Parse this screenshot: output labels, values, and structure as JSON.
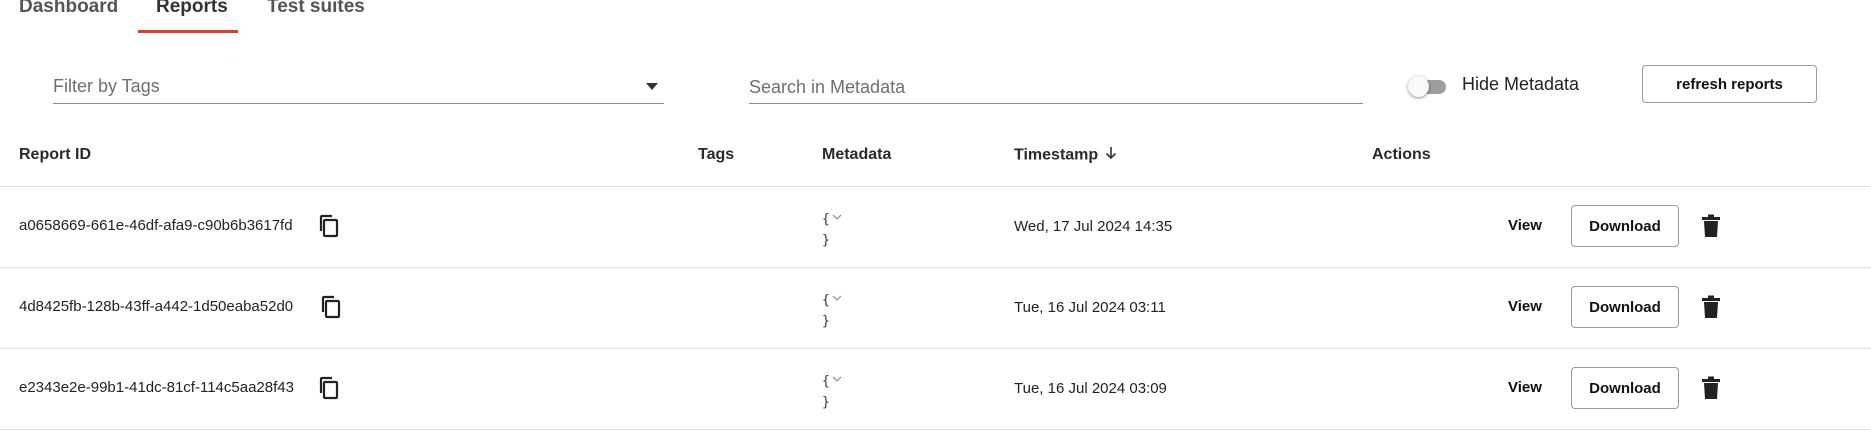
{
  "tabs": [
    {
      "label": "Dashboard",
      "active": false
    },
    {
      "label": "Reports",
      "active": true
    },
    {
      "label": "Test suites",
      "active": false
    }
  ],
  "filters": {
    "tags_placeholder": "Filter by Tags",
    "search_placeholder": "Search in Metadata",
    "hide_metadata_label": "Hide Metadata",
    "hide_metadata_on": false,
    "refresh_label": "refresh reports"
  },
  "table": {
    "columns": {
      "report_id": "Report ID",
      "tags": "Tags",
      "metadata": "Metadata",
      "timestamp": "Timestamp",
      "actions": "Actions"
    },
    "sort": {
      "column": "timestamp",
      "direction": "descending"
    },
    "rows": [
      {
        "id": "a0658669-661e-46df-afa9-c90b6b3617fd",
        "metadata_open": "{",
        "metadata_close": "}",
        "timestamp": "Wed, 17 Jul 2024 14:35",
        "view": "View",
        "download": "Download"
      },
      {
        "id": "4d8425fb-128b-43ff-a442-1d50eaba52d0",
        "metadata_open": "{",
        "metadata_close": "}",
        "timestamp": "Tue, 16 Jul 2024 03:11",
        "view": "View",
        "download": "Download"
      },
      {
        "id": "e2343e2e-99b1-41dc-81cf-114c5aa28f43",
        "metadata_open": "{",
        "metadata_close": "}",
        "timestamp": "Tue, 16 Jul 2024 03:09",
        "view": "View",
        "download": "Download"
      }
    ]
  },
  "icons": {
    "copy": "copy-icon",
    "delete": "trash-icon",
    "sort": "arrow-down-icon",
    "expand": "chevron-down-icon",
    "dropdown": "caret-down-icon"
  },
  "colors": {
    "accent": "#e53935",
    "toggle_track": "#9e9e9e",
    "divider": "#e0e0e0"
  }
}
